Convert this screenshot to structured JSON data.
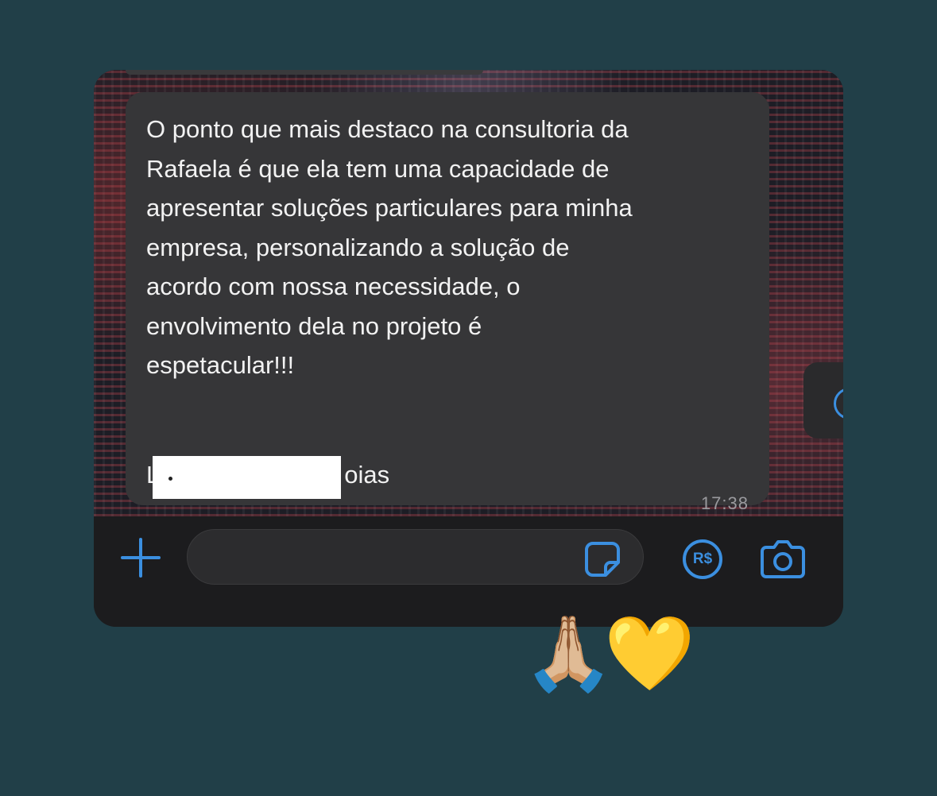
{
  "message": {
    "text": "O ponto que mais destaco na consultoria da\nRafaela é que ela tem uma capacidade de\napresentar soluções particulares para minha\nempresa, personalizando a solução de\nacordo com nossa necessidade, o\nenvolvimento dela no projeto é\nespetacular!!!",
    "signature_visible_start": "L",
    "signature_visible_end": "oias",
    "time": "17:38"
  },
  "input_bar": {
    "placeholder": "",
    "icons": [
      "plus-icon",
      "sticker-icon",
      "pix-payment-icon",
      "camera-icon"
    ],
    "pix_label": "R$",
    "accent_color": "#3b8fe0"
  },
  "reactions": [
    "🙏🏼",
    "💛"
  ],
  "colors": {
    "background": "#213f48",
    "bubble": "#363638",
    "bar": "#1c1c1e"
  }
}
